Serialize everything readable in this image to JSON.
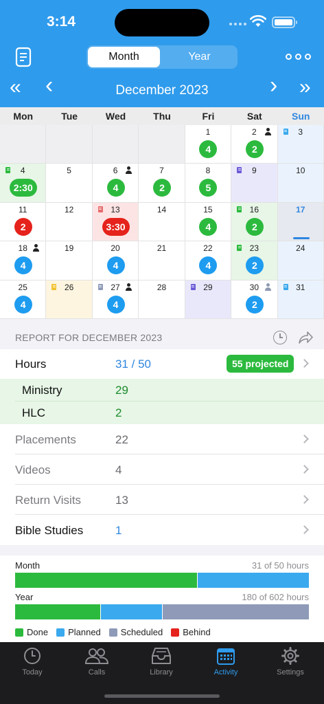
{
  "status": {
    "time": "3:14"
  },
  "header": {
    "segments": [
      "Month",
      "Year"
    ],
    "active_segment": "Month",
    "month_title": "December 2023",
    "nav_first": "«",
    "nav_prev": "‹",
    "nav_next": "›",
    "nav_last": "»",
    "accent": "#2f9bec"
  },
  "weekdays": [
    "Mon",
    "Tue",
    "Wed",
    "Thu",
    "Fri",
    "Sat",
    "Sun"
  ],
  "calendar": {
    "rows": [
      [
        {
          "day": "",
          "bg": "blank"
        },
        {
          "day": "",
          "bg": "blank"
        },
        {
          "day": "",
          "bg": "blank"
        },
        {
          "day": "",
          "bg": "blank"
        },
        {
          "day": "1",
          "badge": "4",
          "badge_color": "green"
        },
        {
          "day": "2",
          "badge": "2",
          "badge_color": "green",
          "person": "dark"
        },
        {
          "day": "3",
          "bg": "sun",
          "note": "blue"
        }
      ],
      [
        {
          "day": "4",
          "bg": "green",
          "note": "green",
          "badge": "2:30",
          "badge_color": "green"
        },
        {
          "day": "5"
        },
        {
          "day": "6",
          "badge": "4",
          "badge_color": "green",
          "person": "dark"
        },
        {
          "day": "7",
          "badge": "2",
          "badge_color": "green"
        },
        {
          "day": "8",
          "badge": "5",
          "badge_color": "green"
        },
        {
          "day": "9",
          "bg": "purple",
          "note": "purple"
        },
        {
          "day": "10"
        }
      ],
      [
        {
          "day": "11",
          "badge": "2",
          "badge_color": "red"
        },
        {
          "day": "12"
        },
        {
          "day": "13",
          "bg": "red",
          "note": "red",
          "badge": "3:30",
          "badge_color": "red"
        },
        {
          "day": "14"
        },
        {
          "day": "15",
          "badge": "4",
          "badge_color": "green"
        },
        {
          "day": "16",
          "bg": "green",
          "note": "green",
          "badge": "2",
          "badge_color": "green"
        },
        {
          "day": "17",
          "bg": "today",
          "today": true
        }
      ],
      [
        {
          "day": "18",
          "badge": "4",
          "badge_color": "blue",
          "person": "dark"
        },
        {
          "day": "19"
        },
        {
          "day": "20",
          "badge": "4",
          "badge_color": "blue"
        },
        {
          "day": "21"
        },
        {
          "day": "22",
          "badge": "4",
          "badge_color": "blue"
        },
        {
          "day": "23",
          "bg": "green",
          "note": "green",
          "badge": "2",
          "badge_color": "blue"
        },
        {
          "day": "24"
        }
      ],
      [
        {
          "day": "25",
          "badge": "4",
          "badge_color": "blue"
        },
        {
          "day": "26",
          "bg": "yellow",
          "note": "yellow"
        },
        {
          "day": "27",
          "note": "slate",
          "badge": "4",
          "badge_color": "blue",
          "person": "dark"
        },
        {
          "day": "28"
        },
        {
          "day": "29",
          "bg": "purple",
          "note": "purple"
        },
        {
          "day": "30",
          "badge": "2",
          "badge_color": "blue",
          "person": "grey"
        },
        {
          "day": "31",
          "bg": "sun",
          "note": "blue"
        }
      ]
    ]
  },
  "report": {
    "title": "REPORT FOR DECEMBER 2023",
    "hours_label": "Hours",
    "hours_value": "31 / 50",
    "projected": "55 projected",
    "ministry_label": "Ministry",
    "ministry_value": "29",
    "hlc_label": "HLC",
    "hlc_value": "2",
    "placements_label": "Placements",
    "placements_value": "22",
    "videos_label": "Videos",
    "videos_value": "4",
    "return_visits_label": "Return Visits",
    "return_visits_value": "13",
    "bible_studies_label": "Bible Studies",
    "bible_studies_value": "1"
  },
  "progress": {
    "month_label": "Month",
    "month_summary": "31 of 50 hours",
    "month_done_fraction": 0.62,
    "month_planned_fraction": 0.38,
    "year_label": "Year",
    "year_summary": "180 of 602 hours",
    "year_done_fraction": 0.29,
    "year_planned_fraction": 0.21,
    "year_scheduled_fraction": 0.5,
    "legend": {
      "done": "Done",
      "planned": "Planned",
      "scheduled": "Scheduled",
      "behind": "Behind"
    },
    "colors": {
      "done": "#2cba3e",
      "planned": "#3aa9ee",
      "scheduled": "#8e9ab8",
      "behind": "#e5221b"
    }
  },
  "tabs": [
    {
      "label": "Today",
      "icon": "clock-icon"
    },
    {
      "label": "Calls",
      "icon": "people-icon"
    },
    {
      "label": "Library",
      "icon": "tray-icon"
    },
    {
      "label": "Activity",
      "icon": "calendar-icon",
      "active": true
    },
    {
      "label": "Settings",
      "icon": "gear-icon"
    }
  ]
}
